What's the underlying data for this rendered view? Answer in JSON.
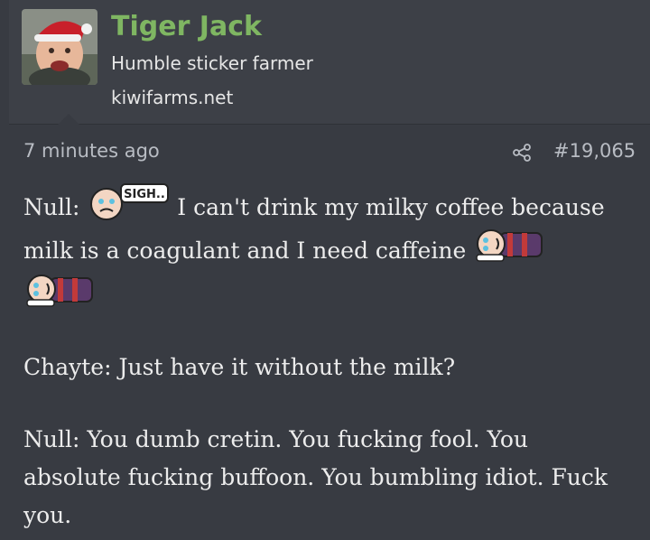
{
  "author": {
    "name": "Tiger Jack",
    "title": "Humble sticker farmer",
    "site": "kiwifarms.net",
    "avatar_icon": "avatar-image"
  },
  "post": {
    "time": "7 minutes ago",
    "number": "#19,065",
    "lines": {
      "l1a": "Null:",
      "l1b": "I can't drink my milky coffee because",
      "l2": "milk is a coagulant and I need caffeine",
      "l3": "Chayte: Just have it without the milk?",
      "l4": "Null: You dumb cretin. You fucking fool. You",
      "l5": "absolute fucking buffoon. You bumbling idiot. Fuck",
      "l6": "you."
    },
    "smiley_sigh_text": "SIGH.."
  },
  "colors": {
    "username": "#7fb662",
    "background": "#383b42",
    "header": "#3d4047"
  }
}
